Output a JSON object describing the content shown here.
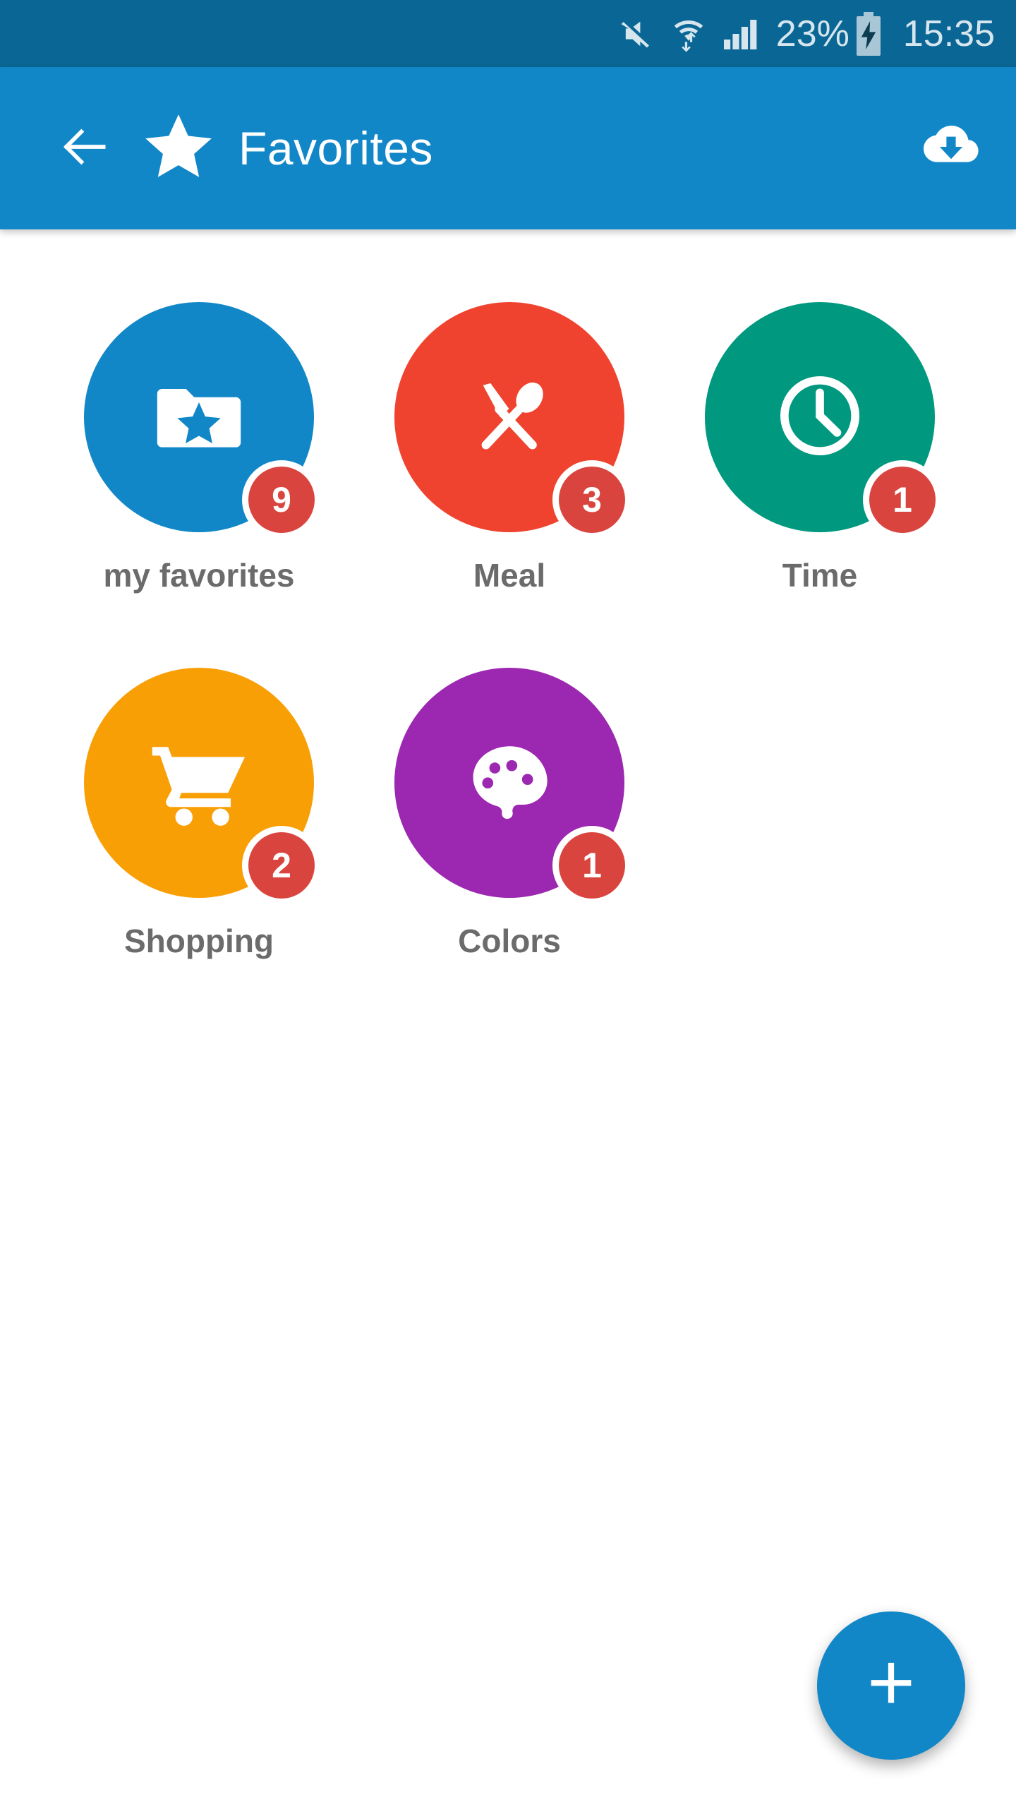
{
  "status_bar": {
    "background": "#0a6694",
    "icons": [
      "mute-icon",
      "wifi-icon",
      "signal-icon"
    ],
    "battery_percent": "23%",
    "battery_state": "charging",
    "clock": "15:35"
  },
  "app_bar": {
    "background": "#1287c8",
    "back_icon": "back-arrow-icon",
    "brand_icon": "star-icon",
    "title": "Favorites",
    "action_icon": "cloud-download-icon"
  },
  "grid": {
    "items": [
      {
        "label": "my favorites",
        "badge": "9",
        "color": "#1287c8",
        "icon": "folder-star-icon"
      },
      {
        "label": "Meal",
        "badge": "3",
        "color": "#f0432f",
        "icon": "cutlery-icon"
      },
      {
        "label": "Time",
        "badge": "1",
        "color": "#00997f",
        "icon": "clock-icon"
      },
      {
        "label": "Shopping",
        "badge": "2",
        "color": "#f99f06",
        "icon": "shopping-cart-icon"
      },
      {
        "label": "Colors",
        "badge": "1",
        "color": "#9c27b0",
        "icon": "palette-icon"
      }
    ],
    "badge_color": "#d9453e",
    "label_color": "#6b6b6b"
  },
  "fab": {
    "icon": "plus-icon",
    "color": "#1287c8",
    "label": "+"
  }
}
